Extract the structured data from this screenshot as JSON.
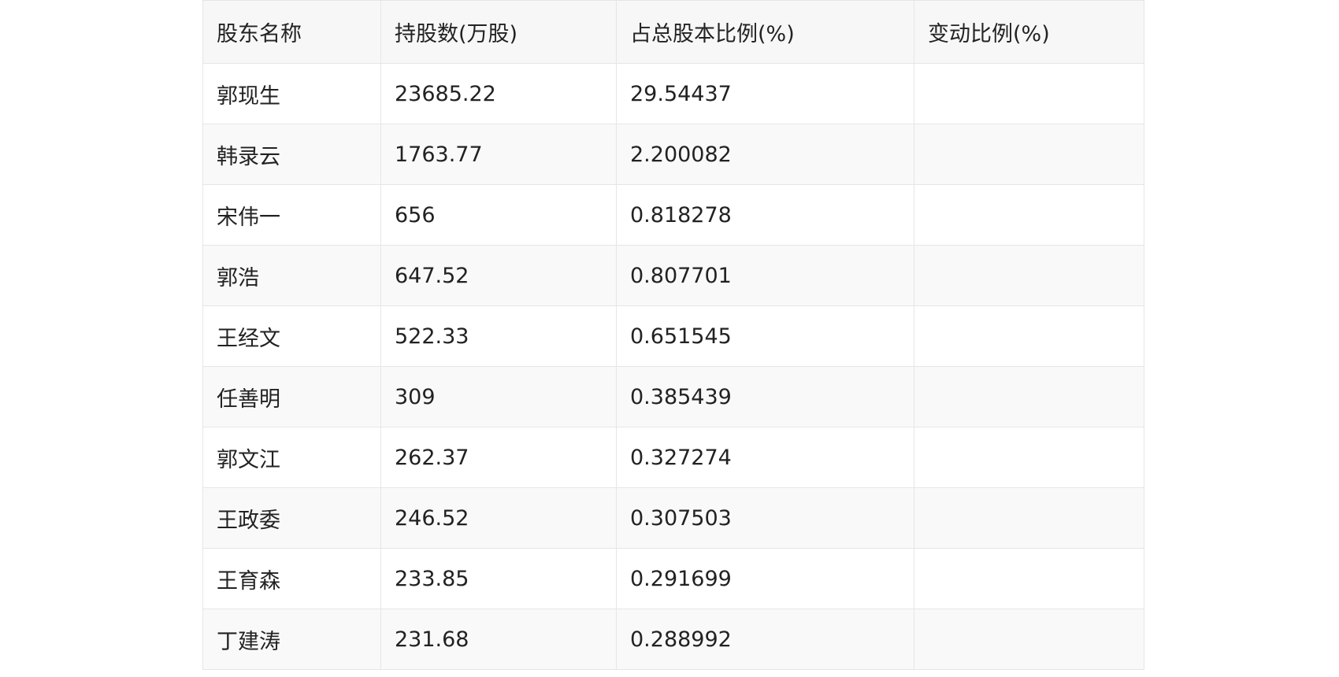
{
  "table": {
    "headers": [
      "股东名称",
      "持股数(万股)",
      "占总股本比例(%)",
      "变动比例(%)"
    ],
    "rows": [
      [
        "郭现生",
        "23685.22",
        "29.54437",
        ""
      ],
      [
        "韩录云",
        "1763.77",
        "2.200082",
        ""
      ],
      [
        "宋伟一",
        "656",
        "0.818278",
        ""
      ],
      [
        "郭浩",
        "647.52",
        "0.807701",
        ""
      ],
      [
        "王经文",
        "522.33",
        "0.651545",
        ""
      ],
      [
        "任善明",
        "309",
        "0.385439",
        ""
      ],
      [
        "郭文江",
        "262.37",
        "0.327274",
        ""
      ],
      [
        "王政委",
        "246.52",
        "0.307503",
        ""
      ],
      [
        "王育森",
        "233.85",
        "0.291699",
        ""
      ],
      [
        "丁建涛",
        "231.68",
        "0.288992",
        ""
      ]
    ]
  }
}
